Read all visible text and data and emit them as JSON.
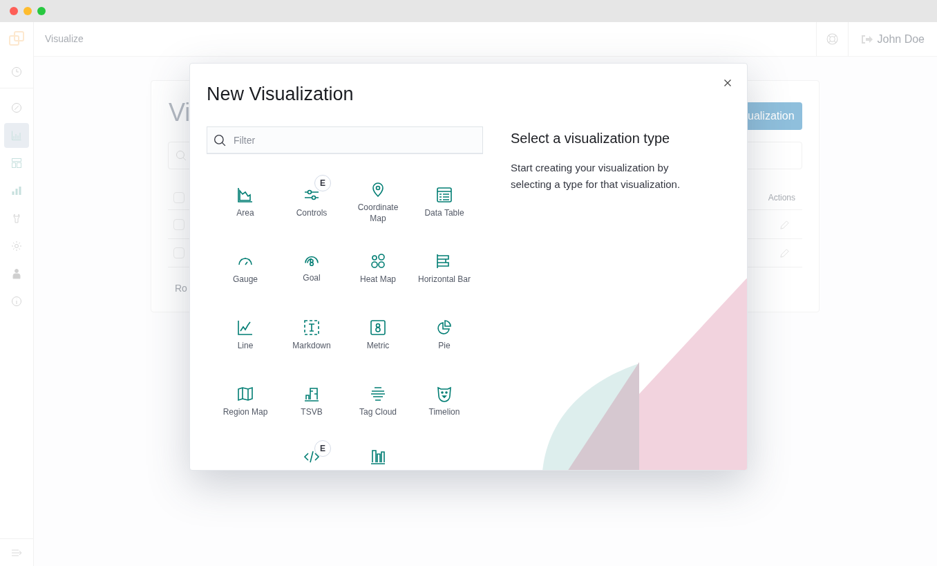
{
  "sidebar": {
    "items": [
      {
        "kind": "recent",
        "selected": false
      },
      {
        "kind": "discover",
        "selected": false
      },
      {
        "kind": "visualize",
        "selected": true
      },
      {
        "kind": "dashboard",
        "selected": false
      },
      {
        "kind": "timelion",
        "selected": false
      },
      {
        "kind": "devtools",
        "selected": false
      },
      {
        "kind": "management",
        "selected": false
      },
      {
        "kind": "user",
        "selected": false
      },
      {
        "kind": "info",
        "selected": false
      }
    ]
  },
  "header": {
    "breadcrumb": "Visualize",
    "user": "John Doe"
  },
  "background_page": {
    "title": "Vi",
    "create_button": "ualization",
    "actions_column": "Actions",
    "header_checked": false,
    "footer": "Ro",
    "rows": [
      {
        "checked": false
      },
      {
        "checked": false
      }
    ]
  },
  "modal": {
    "title": "New Visualization",
    "search": {
      "placeholder": "Filter"
    },
    "help_title": "Select a visualization type",
    "help_text": "Start creating your visualization by selecting a type for that visualization.",
    "types": [
      {
        "label": "Area"
      },
      {
        "label": "Controls",
        "badge": "E"
      },
      {
        "label": "Coordinate Map"
      },
      {
        "label": "Data Table"
      },
      {
        "label": "Gauge"
      },
      {
        "label": "Goal"
      },
      {
        "label": "Heat Map"
      },
      {
        "label": "Horizontal Bar"
      },
      {
        "label": "Line"
      },
      {
        "label": "Markdown"
      },
      {
        "label": "Metric"
      },
      {
        "label": "Pie"
      },
      {
        "label": "Region Map"
      },
      {
        "label": "TSVB"
      },
      {
        "label": "Tag Cloud"
      },
      {
        "label": "Timelion"
      },
      {
        "kind": "icon_only",
        "badge": "E"
      },
      {
        "kind": "icon_only"
      }
    ]
  }
}
